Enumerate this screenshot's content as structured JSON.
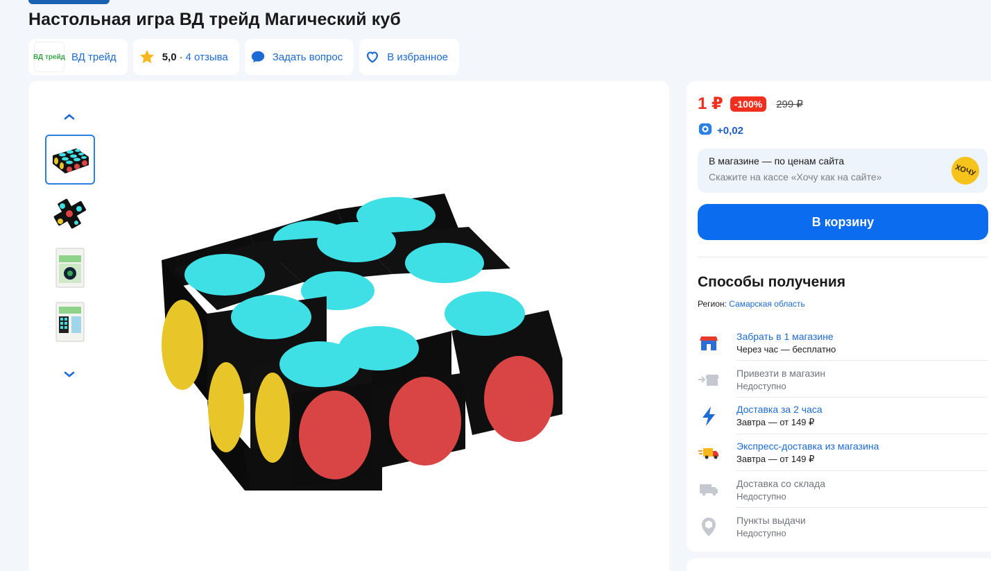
{
  "product": {
    "title": "Настольная игра ВД трейд Магический куб"
  },
  "chips": {
    "brand_logo_text": "ВД трейд",
    "brand": "ВД трейд",
    "rating": "5,0",
    "reviews": "4 отзыва",
    "ask": "Задать вопрос",
    "favorite": "В избранное"
  },
  "price": {
    "current": "1 ₽",
    "discount": "-100%",
    "old": "299 ₽",
    "bonus": "+0,02"
  },
  "store_banner": {
    "line1": "В магазине — по ценам сайта",
    "line2": "Скажите на кассе «Хочу как на сайте»",
    "badge": "ХОЧУ"
  },
  "cart_button": "В корзину",
  "delivery": {
    "title": "Способы получения",
    "region_label": "Регион:",
    "region_value": "Самарская область",
    "options": [
      {
        "title": "Забрать в 1 магазине",
        "sub": "Через час — бесплатно",
        "available": true,
        "icon": "store-icon"
      },
      {
        "title": "Привезти в магазин",
        "sub": "Недоступно",
        "available": false,
        "icon": "store-transfer-icon"
      },
      {
        "title": "Доставка за 2 часа",
        "sub": "Завтра — от 149 ₽",
        "available": true,
        "icon": "lightning-icon"
      },
      {
        "title": "Экспресс-доставка из магазина",
        "sub": "Завтра — от 149 ₽",
        "available": true,
        "icon": "express-truck-icon"
      },
      {
        "title": "Доставка со склада",
        "sub": "Недоступно",
        "available": false,
        "icon": "truck-icon"
      },
      {
        "title": "Пункты выдачи",
        "sub": "Недоступно",
        "available": false,
        "icon": "pickup-point-icon"
      }
    ]
  },
  "colors": {
    "accent": "#0b6cf0",
    "link": "#1c6ad4",
    "price": "#f02f1e",
    "cube_teal": "#3ee0e6",
    "cube_red": "#d94545",
    "cube_yellow": "#e8c62a"
  }
}
